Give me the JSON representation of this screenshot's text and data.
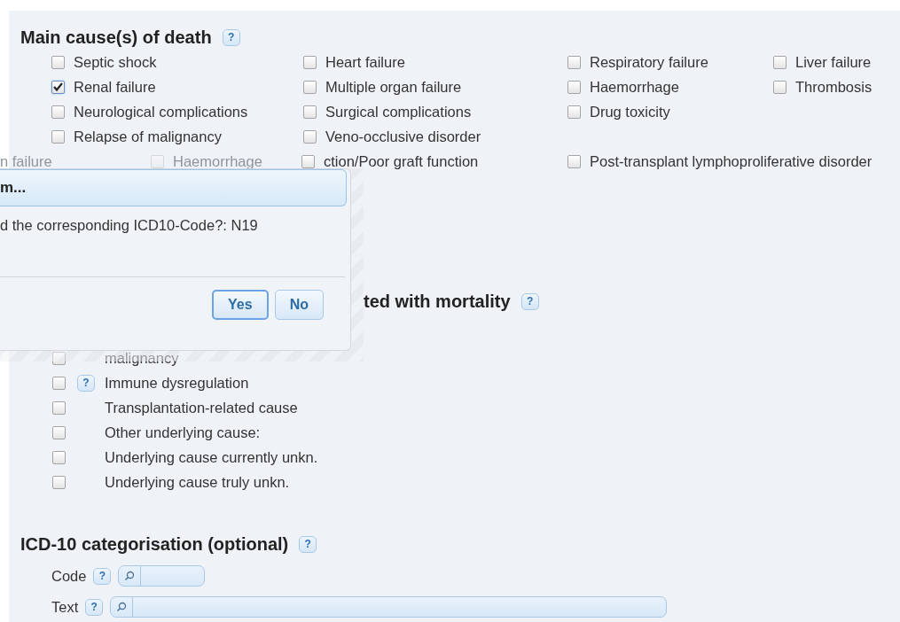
{
  "main_causes": {
    "title": "Main cause(s) of death",
    "help": "?",
    "columns": [
      [
        {
          "label": "Septic shock",
          "checked": false
        },
        {
          "label": "Renal failure",
          "checked": true
        },
        {
          "label": "Neurological complications",
          "checked": false
        },
        {
          "label": "Relapse of malignancy",
          "checked": false
        }
      ],
      [
        {
          "label": "Heart failure",
          "checked": false
        },
        {
          "label": "Multiple organ failure",
          "checked": false
        },
        {
          "label": "Surgical complications",
          "checked": false
        },
        {
          "label": "Veno-occlusive disorder",
          "checked": false
        }
      ],
      [
        {
          "label": "Respiratory failure",
          "checked": false
        },
        {
          "label": "Haemorrhage",
          "checked": false
        },
        {
          "label": "Drug toxicity",
          "checked": false
        }
      ],
      [
        {
          "label": "Liver failure",
          "checked": false
        },
        {
          "label": "Thrombosis",
          "checked": false
        }
      ]
    ],
    "partly_hidden_row": [
      {
        "kind": "text",
        "label": "n failure",
        "faded": true
      },
      {
        "kind": "checkbox",
        "label": "Haemorrhage",
        "faded": true,
        "checked": false
      },
      {
        "kind": "checkbox",
        "label": "ction/Poor graft function",
        "faded": false,
        "checked": false
      },
      {
        "kind": "checkbox",
        "label": "Post-transplant lymphoproliferative disorder",
        "faded": false,
        "checked": false
      }
    ]
  },
  "mortality_section": {
    "title": "ted with mortality",
    "help": "?",
    "options": [
      {
        "label": "malignancy",
        "checked": false
      },
      {
        "label": "Immune dysregulation",
        "checked": false,
        "help": "?"
      },
      {
        "label": "Transplantation-related cause",
        "checked": false
      },
      {
        "label": "Other underlying cause:",
        "checked": false
      },
      {
        "label": "Underlying cause currently unkn.",
        "checked": false
      },
      {
        "label": "Underlying cause truly unkn.",
        "checked": false
      }
    ]
  },
  "icd_section": {
    "title": "ICD-10 categorisation (optional)",
    "help": "?",
    "fields": [
      {
        "label": "Code",
        "help": "?",
        "kind": "short"
      },
      {
        "label": "Text",
        "help": "?",
        "kind": "long"
      }
    ]
  },
  "dialog": {
    "title": "m...",
    "message": "d the corresponding ICD10-Code?: N19",
    "buttons": [
      {
        "label": "Yes",
        "focused": true
      },
      {
        "label": "No",
        "focused": false
      }
    ]
  }
}
